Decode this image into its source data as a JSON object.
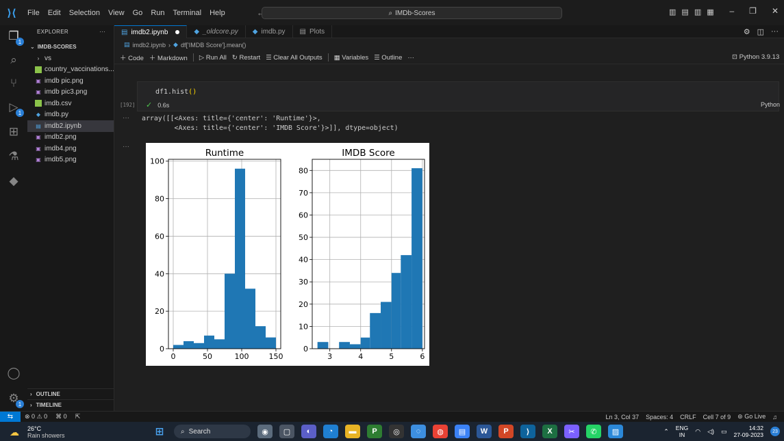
{
  "titlebar": {
    "menu": [
      "File",
      "Edit",
      "Selection",
      "View",
      "Go",
      "Run",
      "Terminal",
      "Help"
    ],
    "search": "IMDb-Scores"
  },
  "sidebar": {
    "header": "EXPLORER",
    "folder": "IMDB-SCORES",
    "items": [
      {
        "label": "vs",
        "icon": "chevron-right-icon",
        "color": "#cccccc"
      },
      {
        "label": "country_vaccinations....",
        "icon": "csv-icon",
        "color": "#8bc34a"
      },
      {
        "label": "imdb pic.png",
        "icon": "image-icon",
        "color": "#b180d7"
      },
      {
        "label": "imdb pic3.png",
        "icon": "image-icon",
        "color": "#b180d7"
      },
      {
        "label": "imdb.csv",
        "icon": "csv-icon",
        "color": "#8bc34a"
      },
      {
        "label": "imdb.py",
        "icon": "python-icon",
        "color": "#4fa3e0"
      },
      {
        "label": "imdb2.ipynb",
        "icon": "notebook-icon",
        "color": "#4fa3e0"
      },
      {
        "label": "imdb2.png",
        "icon": "image-icon",
        "color": "#b180d7"
      },
      {
        "label": "imdb4.png",
        "icon": "image-icon",
        "color": "#b180d7"
      },
      {
        "label": "imdb5.png",
        "icon": "image-icon",
        "color": "#b180d7"
      }
    ],
    "outline": "OUTLINE",
    "timeline": "TIMELINE"
  },
  "tabs": [
    {
      "label": "imdb2.ipynb",
      "active": true
    },
    {
      "label": "_oldcore.py",
      "active": false
    },
    {
      "label": "imdb.py",
      "active": false
    },
    {
      "label": "Plots",
      "active": false
    }
  ],
  "breadcrumb": {
    "file": "imdb2.ipynb",
    "symbol": "df['IMDB Score'].mean()"
  },
  "toolbar": {
    "code": "Code",
    "markdown": "Markdown",
    "run_all": "Run All",
    "restart": "Restart",
    "clear": "Clear All Outputs",
    "variables": "Variables",
    "outline": "Outline",
    "kernel": "Python 3.9.13"
  },
  "cell": {
    "code_prefix": "df1.hist",
    "code_parens": "()",
    "exec_count": "[192]",
    "duration": "0.6s",
    "language": "Python",
    "output_text": "array([[<Axes: title={'center': 'Runtime'}>,\n        <Axes: title={'center': 'IMDB Score'}>]], dtype=object)"
  },
  "chart_data": [
    {
      "type": "bar",
      "title": "Runtime",
      "bin_edges": [
        0,
        15,
        30,
        45,
        60,
        75,
        90,
        105,
        120,
        135,
        150
      ],
      "values": [
        2,
        4,
        3,
        7,
        5,
        40,
        96,
        32,
        12,
        6
      ],
      "xticks": [
        0,
        50,
        100,
        150
      ],
      "yticks": [
        0,
        20,
        40,
        60,
        80,
        100
      ],
      "xlim": [
        -7,
        157
      ],
      "ylim": [
        0,
        101
      ],
      "grid": true,
      "color": "#1f77b4"
    },
    {
      "type": "bar",
      "title": "IMDB Score",
      "bin_edges": [
        2.6,
        2.95,
        3.3,
        3.65,
        4.0,
        4.3,
        4.65,
        5.0,
        5.3,
        5.65,
        6.0
      ],
      "values": [
        3,
        0,
        3,
        2,
        5,
        16,
        21,
        34,
        42,
        81
      ],
      "xticks": [
        3,
        4,
        5,
        6
      ],
      "yticks": [
        0,
        10,
        20,
        30,
        40,
        50,
        60,
        70,
        80
      ],
      "xlim": [
        2.43,
        6.07
      ],
      "ylim": [
        0,
        85
      ],
      "grid": true,
      "color": "#1f77b4"
    }
  ],
  "statusbar": {
    "errors": "0",
    "warnings": "0",
    "ports": "0",
    "position": "Ln 3, Col 37",
    "spaces": "Spaces: 4",
    "eol": "CRLF",
    "cell": "Cell 7 of 9",
    "golive": "Go Live"
  },
  "taskbar": {
    "temp": "26°C",
    "weather": "Rain showers",
    "search": "Search",
    "lang": "ENG",
    "region": "IN",
    "time": "14:32",
    "date": "27-09-2023",
    "notifications": "23"
  }
}
